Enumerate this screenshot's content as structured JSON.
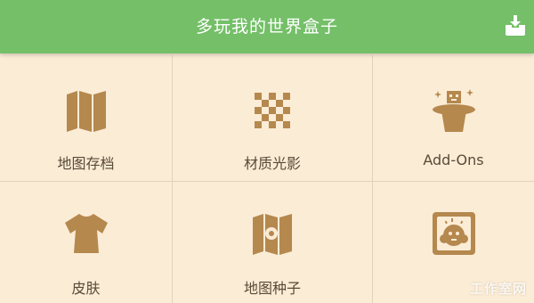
{
  "header": {
    "title": "多玩我的世界盒子"
  },
  "tiles": [
    {
      "label": "地图存档",
      "icon": "folded-map-icon"
    },
    {
      "label": "材质光影",
      "icon": "checkerboard-icon"
    },
    {
      "label": "Add-Ons",
      "icon": "magic-hat-icon"
    },
    {
      "label": "皮肤",
      "icon": "shirt-icon"
    },
    {
      "label": "地图种子",
      "icon": "map-seed-icon"
    },
    {
      "label": "",
      "icon": "creature-frame-icon"
    }
  ],
  "watermark": "工作室网",
  "colors": {
    "header": "#74bf68",
    "background": "#fbecd6",
    "icon": "#b5884e",
    "label": "#5a4a38"
  }
}
